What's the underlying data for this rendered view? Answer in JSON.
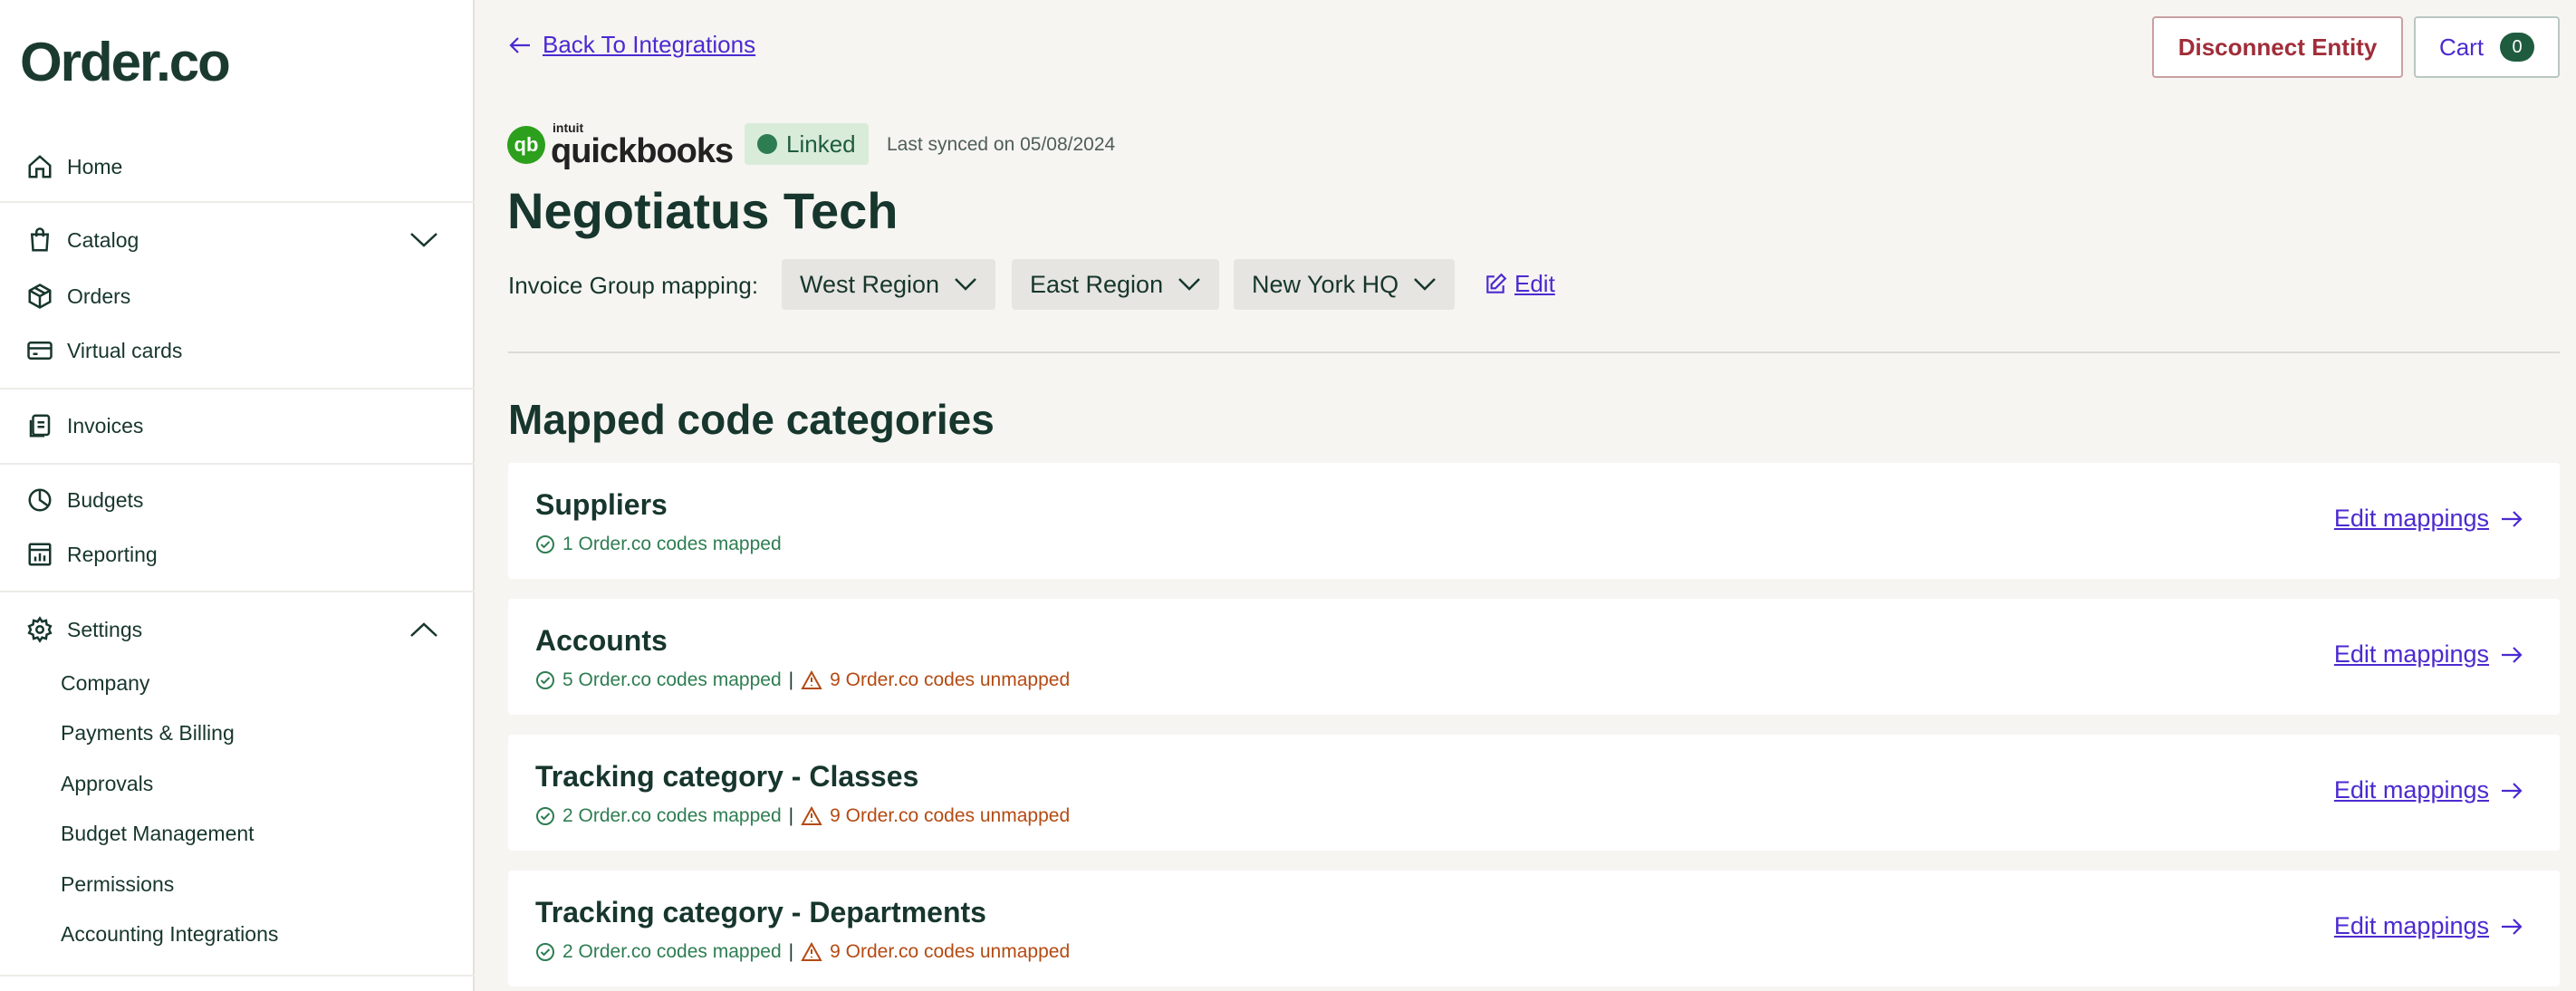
{
  "app": {
    "logo": "Order.co"
  },
  "sidebar": {
    "items": [
      {
        "label": "Home",
        "icon": "home-icon"
      },
      {
        "label": "Catalog",
        "icon": "shopping-bag-icon"
      },
      {
        "label": "Orders",
        "icon": "package-icon"
      },
      {
        "label": "Virtual cards",
        "icon": "credit-card-icon"
      },
      {
        "label": "Invoices",
        "icon": "invoice-icon"
      },
      {
        "label": "Budgets",
        "icon": "pie-chart-icon"
      },
      {
        "label": "Reporting",
        "icon": "reporting-icon"
      },
      {
        "label": "Settings",
        "icon": "gear-icon"
      }
    ],
    "settings_sub": [
      "Company",
      "Payments & Billing",
      "Approvals",
      "Budget Management",
      "Permissions",
      "Accounting Integrations"
    ]
  },
  "header": {
    "back_label": "Back To Integrations",
    "disconnect_label": "Disconnect Entity",
    "cart_label": "Cart",
    "cart_count": "0"
  },
  "integration": {
    "brand_small": "intuit",
    "brand_name": "quickbooks",
    "brand_mark": "qb",
    "status": "Linked",
    "last_synced": "Last synced on 05/08/2024",
    "entity_name": "Negotiatus Tech",
    "mapping_label": "Invoice Group mapping:",
    "regions": [
      "West Region",
      "East Region",
      "New York HQ"
    ],
    "edit_label": "Edit"
  },
  "mapped": {
    "title": "Mapped code categories",
    "link_label": "Edit mappings",
    "categories": [
      {
        "name": "Suppliers",
        "mapped": "1 Order.co codes mapped",
        "unmapped": ""
      },
      {
        "name": "Accounts",
        "mapped": "5 Order.co codes mapped",
        "unmapped": "9 Order.co codes unmapped"
      },
      {
        "name": "Tracking category - Classes",
        "mapped": "2 Order.co codes mapped",
        "unmapped": "9 Order.co codes unmapped"
      },
      {
        "name": "Tracking category - Departments",
        "mapped": "2 Order.co codes mapped",
        "unmapped": "9 Order.co codes unmapped"
      }
    ],
    "separator": "|"
  }
}
